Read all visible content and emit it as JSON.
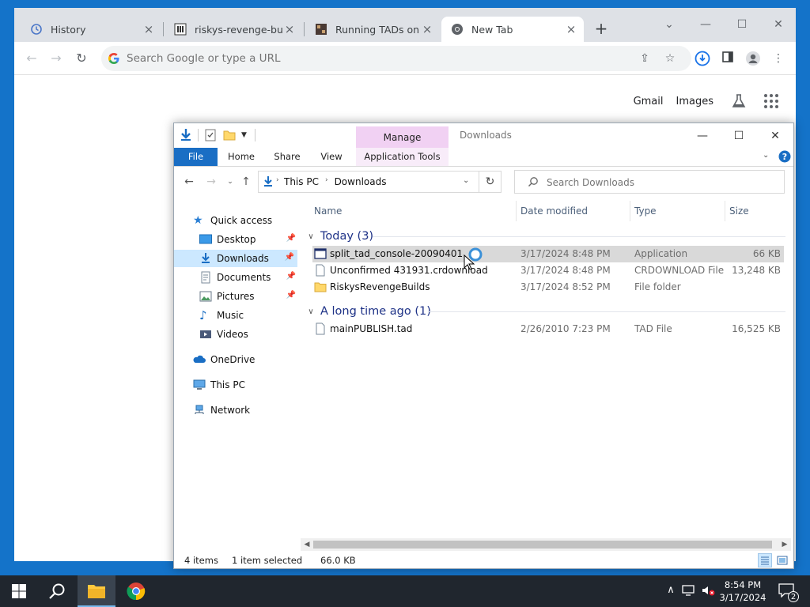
{
  "colors": {
    "desktop": "#1473c9",
    "chrome_tabstrip": "#dee1e6",
    "manage_tab": "#f1d1f3",
    "file_tab": "#1a6ec4",
    "selection": "#cce8ff",
    "taskbar": "#20262e"
  },
  "chrome": {
    "tabs": [
      {
        "title": "History",
        "icon": "history-icon"
      },
      {
        "title": "riskys-revenge-builds",
        "icon": "github-icon"
      },
      {
        "title": "Running TADs on a re",
        "icon": "site-favicon"
      },
      {
        "title": "New Tab",
        "icon": "chrome-icon",
        "active": true
      }
    ],
    "omnibox_placeholder": "Search Google or type a URL",
    "links": {
      "gmail": "Gmail",
      "images": "Images"
    }
  },
  "explorer": {
    "title": "Downloads",
    "contextual_tab": "Manage",
    "ribbon_tabs": [
      "File",
      "Home",
      "Share",
      "View",
      "Application Tools"
    ],
    "breadcrumb": [
      "This PC",
      "Downloads"
    ],
    "search_placeholder": "Search Downloads",
    "nav": {
      "quick_access": "Quick access",
      "desktop": "Desktop",
      "downloads": "Downloads",
      "documents": "Documents",
      "pictures": "Pictures",
      "music": "Music",
      "videos": "Videos",
      "onedrive": "OneDrive",
      "thispc": "This PC",
      "network": "Network"
    },
    "columns": {
      "name": "Name",
      "date": "Date modified",
      "type": "Type",
      "size": "Size"
    },
    "groups": {
      "today": {
        "label": "Today (3)",
        "files": [
          {
            "name": "split_tad_console-20090401",
            "date": "3/17/2024 8:48 PM",
            "type": "Application",
            "size": "66 KB",
            "selected": true
          },
          {
            "name": "Unconfirmed 431931.crdownload",
            "date": "3/17/2024 8:48 PM",
            "type": "CRDOWNLOAD File",
            "size": "13,248 KB"
          },
          {
            "name": "RiskysRevengeBuilds",
            "date": "3/17/2024 8:52 PM",
            "type": "File folder",
            "size": ""
          }
        ]
      },
      "older": {
        "label": "A long time ago (1)",
        "files": [
          {
            "name": "mainPUBLISH.tad",
            "date": "2/26/2010 7:23 PM",
            "type": "TAD File",
            "size": "16,525 KB"
          }
        ]
      }
    },
    "status": {
      "count": "4 items",
      "selected": "1 item selected",
      "size": "66.0 KB"
    }
  },
  "taskbar": {
    "time": "8:54 PM",
    "date": "3/17/2024",
    "notifications": "2"
  }
}
